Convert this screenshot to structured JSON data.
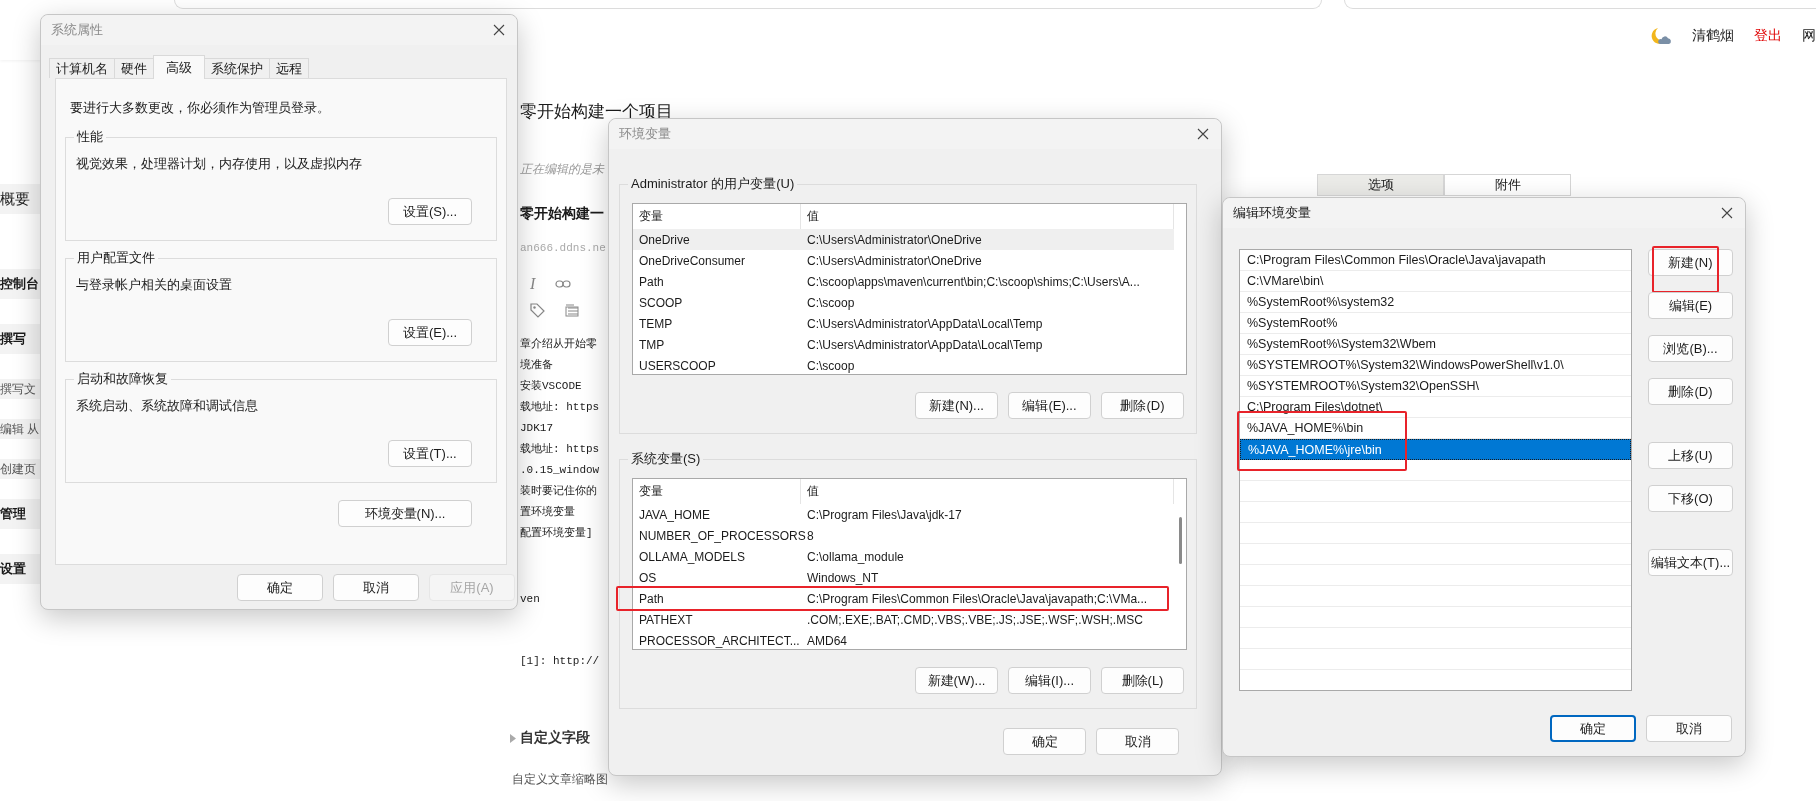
{
  "top_bar": {
    "user": "清鹤烟",
    "logout": "登出",
    "nav_item": "网"
  },
  "sidebar": {
    "items": [
      {
        "label": "概要",
        "kind": "section"
      },
      {
        "label": "控制台",
        "kind": "heading"
      },
      {
        "label": "撰写",
        "kind": "heading"
      },
      {
        "label": "撰写文",
        "kind": "link"
      },
      {
        "label": "编辑 从",
        "kind": "link"
      },
      {
        "label": "创建页",
        "kind": "link"
      },
      {
        "label": "管理",
        "kind": "heading"
      },
      {
        "label": "设置",
        "kind": "heading"
      }
    ]
  },
  "editor": {
    "page_title": "零开始构建一个项目",
    "notice": "正在编辑的是未",
    "post_title": "零开始构建一",
    "permalink": "an666.ddns.ne",
    "italic_button": "I",
    "lines": [
      "章介绍从开始零",
      "境准备",
      "安装VSCODE",
      "载地址: https",
      "JDK17",
      "载地址: https",
      ".0.15_window",
      "装时要记住你的",
      "置环境变量",
      "配置环境变量]"
    ],
    "tail_lines": [
      "ven",
      "[1]: http://"
    ],
    "custom_fields": "自定义字段",
    "thumbnail_label": "自定义文章缩略图",
    "side_tabs": [
      {
        "label": "选项",
        "selected": true
      },
      {
        "label": "附件",
        "selected": false
      }
    ]
  },
  "system_properties": {
    "title": "系统属性",
    "active": false,
    "tabs": [
      {
        "label": "计算机名",
        "selected": false
      },
      {
        "label": "硬件",
        "selected": false
      },
      {
        "label": "高级",
        "selected": true
      },
      {
        "label": "系统保护",
        "selected": false
      },
      {
        "label": "远程",
        "selected": false
      }
    ],
    "admin_note": "要进行大多数更改，你必须作为管理员登录。",
    "groups": [
      {
        "title": "性能",
        "description": "视觉效果，处理器计划，内存使用，以及虚拟内存",
        "button": "设置(S)..."
      },
      {
        "title": "用户配置文件",
        "description": "与登录帐户相关的桌面设置",
        "button": "设置(E)..."
      },
      {
        "title": "启动和故障恢复",
        "description": "系统启动、系统故障和调试信息",
        "button": "设置(T)..."
      }
    ],
    "env_button": "环境变量(N)...",
    "buttons": [
      {
        "label": "确定",
        "disabled": false
      },
      {
        "label": "取消",
        "disabled": false
      },
      {
        "label": "应用(A)",
        "disabled": true
      }
    ]
  },
  "env_vars": {
    "title": "环境变量",
    "active": false,
    "user_vars": {
      "label": "Administrator 的用户变量(U)",
      "columns": [
        "变量",
        "值"
      ],
      "rows": [
        {
          "name": "OneDrive",
          "value": "C:\\Users\\Administrator\\OneDrive",
          "selected": true
        },
        {
          "name": "OneDriveConsumer",
          "value": "C:\\Users\\Administrator\\OneDrive",
          "selected": false
        },
        {
          "name": "Path",
          "value": "C:\\scoop\\apps\\maven\\current\\bin;C:\\scoop\\shims;C:\\Users\\A...",
          "selected": false
        },
        {
          "name": "SCOOP",
          "value": "C:\\scoop",
          "selected": false
        },
        {
          "name": "TEMP",
          "value": "C:\\Users\\Administrator\\AppData\\Local\\Temp",
          "selected": false
        },
        {
          "name": "TMP",
          "value": "C:\\Users\\Administrator\\AppData\\Local\\Temp",
          "selected": false
        },
        {
          "name": "USERSCOOP",
          "value": "C:\\scoop",
          "selected": false
        }
      ],
      "buttons": [
        "新建(N)...",
        "编辑(E)...",
        "删除(D)"
      ]
    },
    "system_vars": {
      "label": "系统变量(S)",
      "columns": [
        "变量",
        "值"
      ],
      "rows": [
        {
          "name": "JAVA_HOME",
          "value": "C:\\Program Files\\Java\\jdk-17",
          "selected": false,
          "marked": false
        },
        {
          "name": "NUMBER_OF_PROCESSORS",
          "value": "8",
          "selected": false,
          "marked": false
        },
        {
          "name": "OLLAMA_MODELS",
          "value": "C:\\ollama_module",
          "selected": false,
          "marked": false
        },
        {
          "name": "OS",
          "value": "Windows_NT",
          "selected": false,
          "marked": false
        },
        {
          "name": "Path",
          "value": "C:\\Program Files\\Common Files\\Oracle\\Java\\javapath;C:\\VMa...",
          "selected": false,
          "marked": true
        },
        {
          "name": "PATHEXT",
          "value": ".COM;.EXE;.BAT;.CMD;.VBS;.VBE;.JS;.JSE;.WSF;.WSH;.MSC",
          "selected": false,
          "marked": false
        },
        {
          "name": "PROCESSOR_ARCHITECT...",
          "value": "AMD64",
          "selected": false,
          "marked": false
        }
      ],
      "buttons": [
        "新建(W)...",
        "编辑(I)...",
        "删除(L)"
      ]
    },
    "buttons": [
      "确定",
      "取消"
    ]
  },
  "edit_env": {
    "title": "编辑环境变量",
    "active": true,
    "entries": [
      {
        "text": "C:\\Program Files\\Common Files\\Oracle\\Java\\javapath",
        "selected": false,
        "marked": false
      },
      {
        "text": "C:\\VMare\\bin\\",
        "selected": false,
        "marked": false
      },
      {
        "text": "%SystemRoot%\\system32",
        "selected": false,
        "marked": false
      },
      {
        "text": "%SystemRoot%",
        "selected": false,
        "marked": false
      },
      {
        "text": "%SystemRoot%\\System32\\Wbem",
        "selected": false,
        "marked": false
      },
      {
        "text": "%SYSTEMROOT%\\System32\\WindowsPowerShell\\v1.0\\",
        "selected": false,
        "marked": false
      },
      {
        "text": "%SYSTEMROOT%\\System32\\OpenSSH\\",
        "selected": false,
        "marked": false
      },
      {
        "text": "C:\\Program Files\\dotnet\\",
        "selected": false,
        "marked": false
      },
      {
        "text": "%JAVA_HOME%\\bin",
        "selected": false,
        "marked": true
      },
      {
        "text": "%JAVA_HOME%\\jre\\bin",
        "selected": true,
        "marked": true
      }
    ],
    "button_groups": [
      [
        {
          "label": "新建(N)",
          "marked": true
        },
        {
          "label": "编辑(E)",
          "marked": false
        },
        {
          "label": "浏览(B)...",
          "marked": false
        },
        {
          "label": "删除(D)",
          "marked": false
        }
      ],
      [
        {
          "label": "上移(U)",
          "marked": false
        },
        {
          "label": "下移(O)",
          "marked": false
        }
      ],
      [
        {
          "label": "编辑文本(T)...",
          "marked": false
        }
      ]
    ],
    "footer_buttons": [
      {
        "label": "确定",
        "default": true
      },
      {
        "label": "取消",
        "default": false
      }
    ]
  }
}
